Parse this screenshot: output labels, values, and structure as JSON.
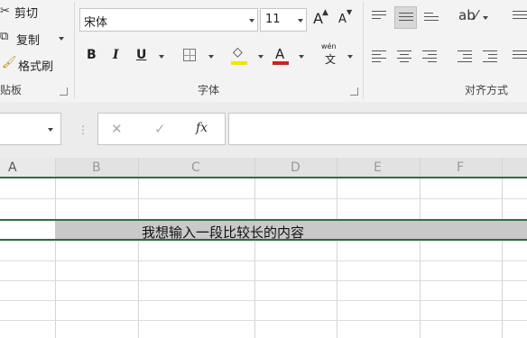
{
  "clipboard": {
    "cut_label": "剪切",
    "copy_label": "复制",
    "format_painter_label": "格式刷",
    "group_label": "贴板"
  },
  "font": {
    "font_name": "宋体",
    "font_size": "11",
    "grow_label": "A",
    "shrink_label": "A",
    "bold_label": "B",
    "italic_label": "I",
    "underline_label": "U",
    "font_color_label": "A",
    "phonetic_top": "wén",
    "phonetic_char": "文",
    "group_label": "字体"
  },
  "alignment": {
    "group_label": "对齐方式"
  },
  "formula_bar": {
    "name_box_value": "",
    "cancel_label": "✕",
    "enter_label": "✓",
    "fx_label": "fx",
    "formula_value": ""
  },
  "grid": {
    "columns": [
      "A",
      "B",
      "C",
      "D",
      "E",
      "F"
    ],
    "merged_cell_text": "我想输入一段比较长的内容"
  },
  "colors": {
    "selection_border": "#2f6f3e",
    "merged_fill": "#c9c9c9",
    "font_color_bar": "#d42020",
    "highlight_yellow": "#f5e400"
  }
}
